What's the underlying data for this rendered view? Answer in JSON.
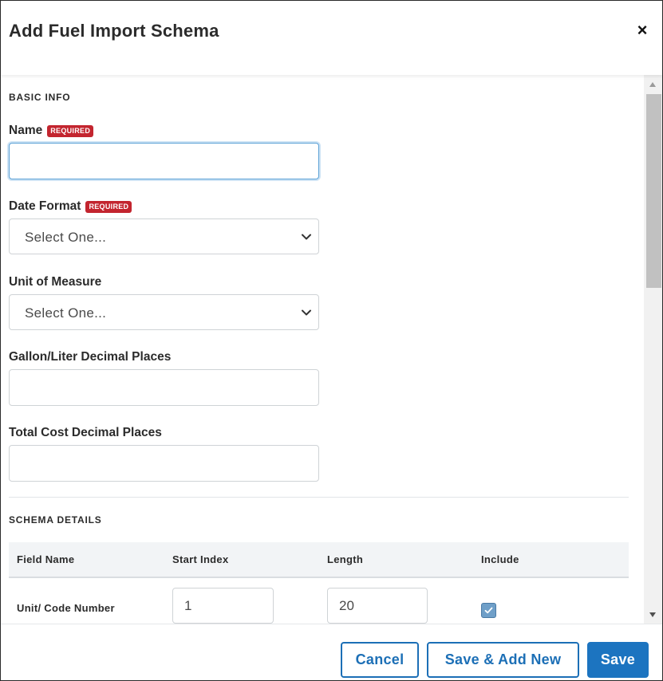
{
  "modal": {
    "title": "Add Fuel Import Schema",
    "close_label": "×"
  },
  "basic_info": {
    "section_title": "BASIC INFO",
    "required_badge": "REQUIRED",
    "name": {
      "label": "Name",
      "value": ""
    },
    "date_format": {
      "label": "Date Format",
      "selected": "Select One..."
    },
    "unit_of_measure": {
      "label": "Unit of Measure",
      "selected": "Select One..."
    },
    "gallon_liter_decimal": {
      "label": "Gallon/Liter Decimal Places",
      "value": ""
    },
    "total_cost_decimal": {
      "label": "Total Cost Decimal Places",
      "value": ""
    }
  },
  "schema_details": {
    "section_title": "SCHEMA DETAILS",
    "columns": [
      "Field Name",
      "Start Index",
      "Length",
      "Include"
    ],
    "rows": [
      {
        "field_name": "Unit/ Code Number",
        "start_index": "1",
        "length": "20",
        "include": true
      }
    ]
  },
  "footer": {
    "cancel_label": "Cancel",
    "save_add_new_label": "Save & Add New",
    "save_label": "Save"
  },
  "colors": {
    "primary": "#1c74c0",
    "required_badge": "#c3252f",
    "checkbox": "#6f9fc8"
  }
}
